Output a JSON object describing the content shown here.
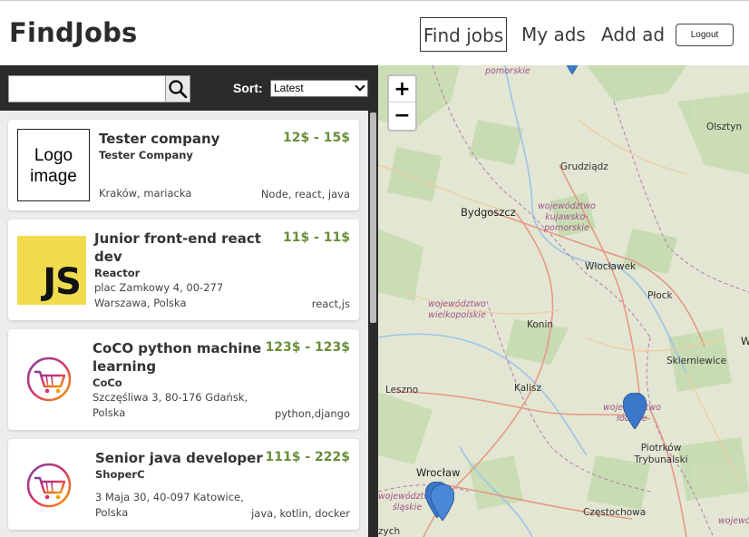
{
  "header": {
    "brand": "FindJobs",
    "nav": {
      "find_jobs": "Find jobs",
      "my_ads": "My ads",
      "add_ad": "Add ad"
    },
    "logout_label": "Logout"
  },
  "search": {
    "value": "",
    "placeholder": "",
    "sort_label": "Sort:",
    "sort_selected": "Latest"
  },
  "jobs": [
    {
      "title": "Tester company",
      "company": "Tester Company",
      "salary": "12$ - 15$",
      "address": "Kraków, mariacka",
      "tags": "Node, react, java",
      "logo_text": "Logo image"
    },
    {
      "title": "Junior front-end react dev",
      "company": "Reactor",
      "salary": "11$ - 11$",
      "address": "plac Zamkowy 4, 00-277 Warszawa, Polska",
      "tags": "react,js",
      "logo_text": "JS"
    },
    {
      "title": "CoCO python machine learning",
      "company": "CoCo",
      "salary": "123$ - 123$",
      "address": "Szczęśliwa 3, 80-176 Gdańsk, Polska",
      "tags": "python,django"
    },
    {
      "title": "Senior java developer",
      "company": "ShoperC",
      "salary": "111$ - 222$",
      "address": "3 Maja 30, 40-097 Katowice, Polska",
      "tags": "java, kotlin, docker"
    }
  ],
  "map": {
    "zoom_in": "+",
    "zoom_out": "−",
    "cities": [
      "Olsztyn",
      "Grudziądz",
      "Bydgoszcz",
      "Włocławek",
      "Płock",
      "Konin",
      "Skierniewice",
      "Leszno",
      "Kalisz",
      "Piotrków Trybunalski",
      "Wrocław",
      "Częstochowa",
      "W",
      "zych"
    ],
    "regions": [
      "pomorskie",
      "województwo kujawsko-pomorskie",
      "województwo wielkopolskie",
      "województwo łódzkie",
      "województwo śląskie",
      "wojewó"
    ],
    "colors": {
      "pin": "#3b78c9",
      "region": "#a0548a",
      "salary": "#6b8e3a"
    }
  }
}
